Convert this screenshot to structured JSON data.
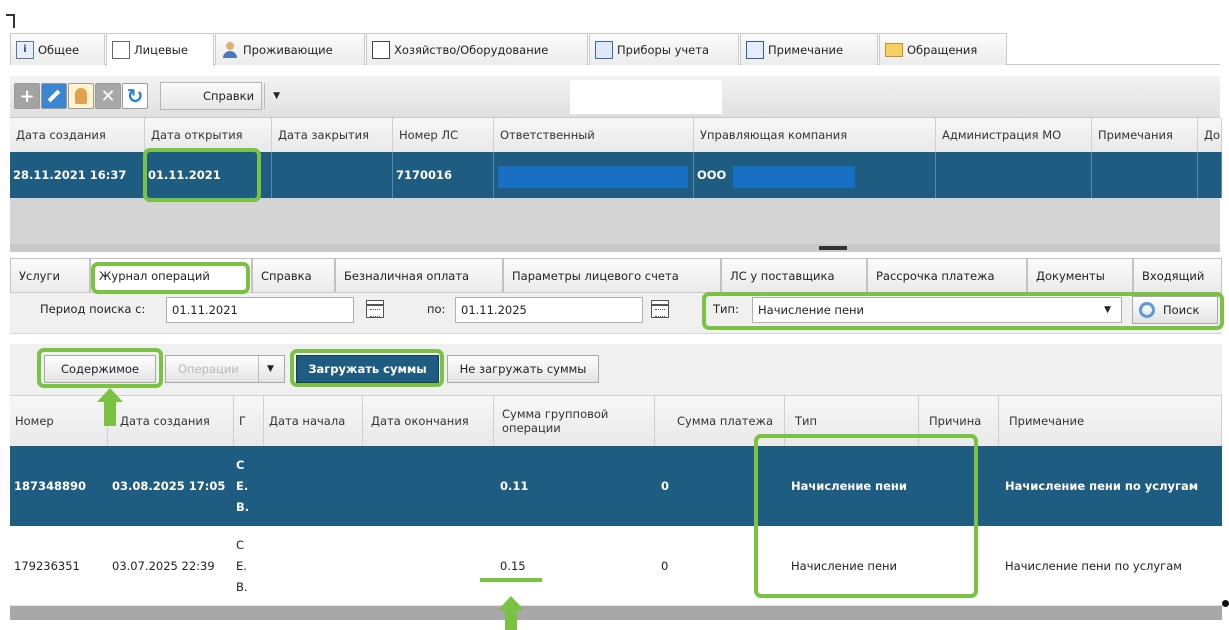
{
  "top_tabs": [
    {
      "label": "Общее",
      "icon": "info-icon"
    },
    {
      "label": "Лицевые",
      "icon": "document-icon"
    },
    {
      "label": "Проживающие",
      "icon": "person-icon"
    },
    {
      "label": "Хозяйство/Оборудование",
      "icon": "calendar-icon"
    },
    {
      "label": "Приборы учета",
      "icon": "meter-icon"
    },
    {
      "label": "Примечание",
      "icon": "note-icon"
    },
    {
      "label": "Обращения",
      "icon": "envelope-icon"
    }
  ],
  "toolbar": {
    "reports_label": "Справки"
  },
  "accounts_grid": {
    "headers": [
      "Дата создания",
      "Дата открытия",
      "Дата закрытия",
      "Номер ЛС",
      "Ответственный",
      "Управляющая компания",
      "Администрация МО",
      "Примечания",
      "До"
    ],
    "row": {
      "created": "28.11.2021 16:37",
      "opened": "01.11.2021",
      "closed": "",
      "account_number": "7170016",
      "responsible": "",
      "company": "ООО",
      "admin": "",
      "notes": "",
      "extra": ""
    }
  },
  "sub_tabs": [
    "Услуги",
    "Журнал операций",
    "Справка",
    "Безналичная оплата",
    "Параметры лицевого счета",
    "ЛС у поставщика",
    "Рассрочка платежа",
    "Документы",
    "Входящий"
  ],
  "search": {
    "period_from_label": "Период поиска с:",
    "period_from": "01.11.2021",
    "period_to_label": "по:",
    "period_to": "01.11.2025",
    "type_label": "Тип:",
    "type_value": "Начисление пени",
    "search_button": "Поиск"
  },
  "actions": {
    "contents": "Содержимое",
    "operations": "Операции",
    "load_sums": "Загружать суммы",
    "no_load_sums": "Не загружать суммы"
  },
  "ops_grid": {
    "headers": [
      "Номер",
      "Дата создания",
      "Г",
      "Дата начала",
      "Дата окончания",
      "Сумма групповой операции",
      "Сумма платежа",
      "Тип",
      "Причина",
      "Примечание"
    ],
    "rows": [
      {
        "number": "187348890",
        "created": "03.08.2025 17:05",
        "g": [
          "С",
          "Е.",
          "В."
        ],
        "start": "",
        "end": "",
        "group_sum": "0.11",
        "payment_sum": "0",
        "type": "Начисление пени",
        "reason": "",
        "note": "Начисление пени по услугам"
      },
      {
        "number": "179236351",
        "created": "03.07.2025 22:39",
        "g": [
          "С",
          "Е.",
          "В."
        ],
        "start": "",
        "end": "",
        "group_sum": "0.15",
        "payment_sum": "0",
        "type": "Начисление пени",
        "reason": "",
        "note": "Начисление пени по услугам"
      }
    ]
  },
  "colors": {
    "selected_row": "#1f5c82",
    "highlight": "#7cc242"
  }
}
